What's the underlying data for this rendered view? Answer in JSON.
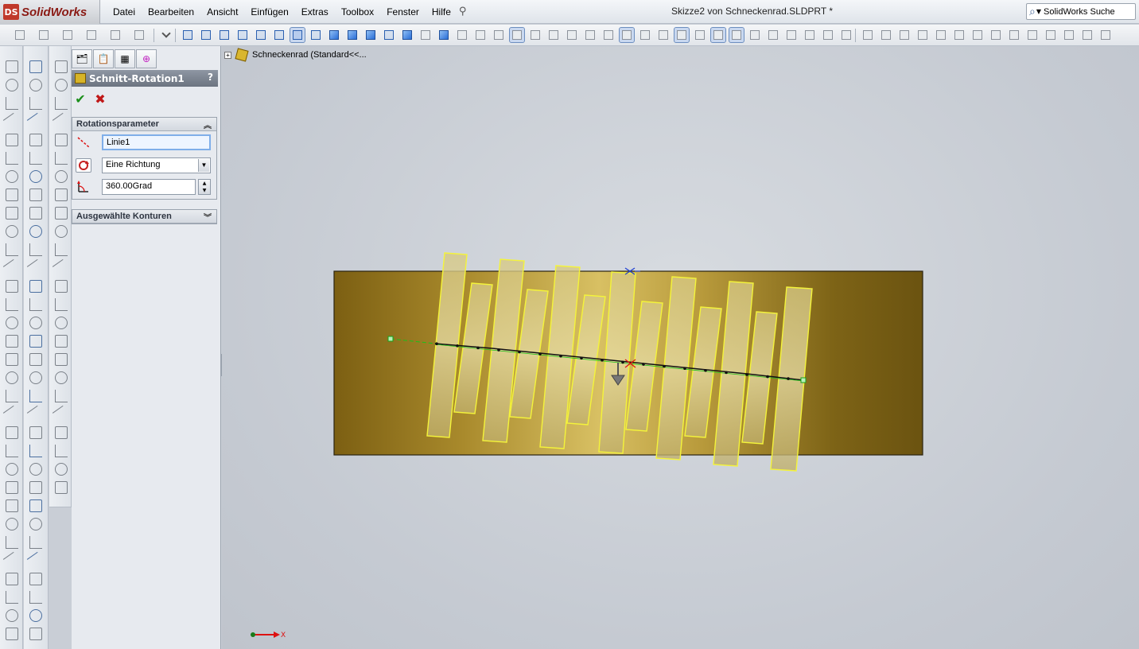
{
  "app": {
    "brand": "SolidWorks",
    "logo_mark": "DS"
  },
  "menu": {
    "items": [
      "Datei",
      "Bearbeiten",
      "Ansicht",
      "Einfügen",
      "Extras",
      "Toolbox",
      "Fenster",
      "Hilfe"
    ]
  },
  "window": {
    "title": "Skizze2 von Schneckenrad.SLDPRT *"
  },
  "search": {
    "label": "SolidWorks Suche"
  },
  "property_manager": {
    "title": "Schnitt-Rotation1",
    "help": "?",
    "tabs": [
      "feature-manager-icon",
      "property-manager-icon",
      "configuration-manager-icon",
      "dimxpert-icon"
    ],
    "ok_glyph": "✔",
    "cancel_glyph": "✖",
    "rotation_group": {
      "label": "Rotationsparameter",
      "axis_value": "Linie1",
      "direction_value": "Eine Richtung",
      "angle_value": "360.00Grad"
    },
    "contours_group": {
      "label": "Ausgewählte Konturen"
    }
  },
  "tree": {
    "root_label": "Schneckenrad  (Standard<<..."
  },
  "triad": {
    "x_label": "X"
  },
  "colors": {
    "model_body": "#8a6d1c",
    "teeth_edge": "#f4f43a",
    "header_bar": "#737b88",
    "ok_green": "#1b8f1b",
    "cancel_red": "#c01818",
    "axis_green": "#19c219"
  }
}
